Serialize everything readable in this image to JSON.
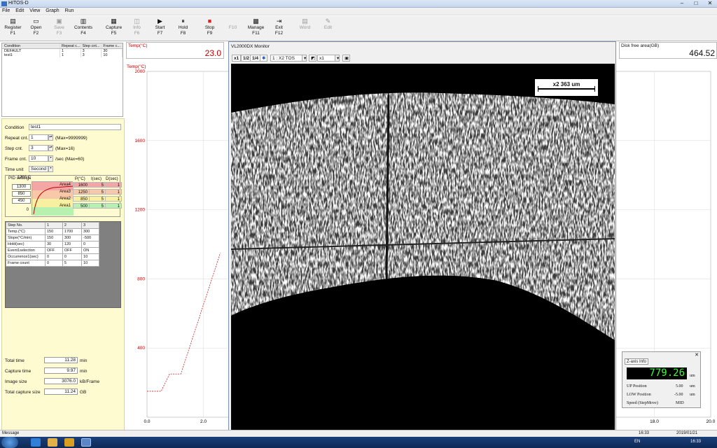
{
  "window": {
    "title": "HITOS-D"
  },
  "menu": [
    "File",
    "Edit",
    "View",
    "Graph",
    "Run"
  ],
  "toolbar": [
    {
      "label": "Register",
      "key": "F1",
      "icon": "register-icon",
      "enabled": true
    },
    {
      "label": "Open",
      "key": "F2",
      "icon": "open-icon",
      "enabled": true
    },
    {
      "label": "Save",
      "key": "F3",
      "icon": "save-icon",
      "enabled": false
    },
    {
      "label": "Contents",
      "key": "F4",
      "icon": "printer-icon",
      "enabled": true
    },
    {
      "label": "Capture",
      "key": "F5",
      "icon": "capture-icon",
      "enabled": true
    },
    {
      "label": "Info",
      "key": "F6",
      "icon": "info-icon",
      "enabled": false
    },
    {
      "label": "Start",
      "key": "F7",
      "icon": "play-icon",
      "enabled": true
    },
    {
      "label": "Hold",
      "key": "F8",
      "icon": "pause-icon",
      "enabled": true
    },
    {
      "label": "Stop",
      "key": "F9",
      "icon": "stop-icon",
      "enabled": true
    },
    {
      "label": "",
      "key": "F10",
      "icon": "",
      "enabled": false
    },
    {
      "label": "Manage",
      "key": "F11",
      "icon": "manage-icon",
      "enabled": true
    },
    {
      "label": "Exit",
      "key": "F12",
      "icon": "exit-icon",
      "enabled": true
    },
    {
      "label": "Word",
      "key": "",
      "icon": "word-icon",
      "enabled": false
    },
    {
      "label": "Edit",
      "key": "",
      "icon": "edit-icon",
      "enabled": false
    }
  ],
  "condition_table": {
    "headers": [
      "Condition",
      "Repeat c...",
      "Step cnt...",
      "Frame c..."
    ],
    "rows": [
      [
        "DEFAULT",
        "1",
        "3",
        "30"
      ],
      [
        "test1",
        "1",
        "3",
        "10"
      ]
    ]
  },
  "settings": {
    "condition_label": "Condition",
    "condition_value": "test1",
    "repeat_label": "Repeat cnt.",
    "repeat_value": "1",
    "repeat_note": "(Max=9999999)",
    "step_label": "Step cnt.",
    "step_value": "3",
    "step_note": "(Max=16)",
    "frame_label": "Frame cnt.",
    "frame_value": "10",
    "frame_note": "/sec (Max=60)",
    "timeunit_label": "Time unit",
    "timeunit_value": "Second"
  },
  "pid": {
    "title": "PID settings",
    "axis_top": "1700",
    "axis_bottom": "0",
    "axis_unit": "C",
    "axis_values": [
      "1300",
      "850",
      "450"
    ],
    "headers": [
      "P(°C)",
      "I(sec)",
      "D(sec)"
    ],
    "rows": [
      {
        "area": "Area4",
        "p": "1600",
        "i": "5",
        "d": "1",
        "color": "#f4a6a6"
      },
      {
        "area": "Area3",
        "p": "1250",
        "i": "5",
        "d": "1",
        "color": "#f8c8a8"
      },
      {
        "area": "Area2",
        "p": "850",
        "i": "5",
        "d": "1",
        "color": "#f7f0a0"
      },
      {
        "area": "Area1",
        "p": "500",
        "i": "5",
        "d": "1",
        "color": "#b8f0b0"
      }
    ]
  },
  "steps": {
    "header": [
      "Step No.",
      "1",
      "2",
      "3"
    ],
    "rows": [
      [
        "Temp.(°C)",
        "150",
        "1700",
        "300"
      ],
      [
        "Slope(°C/min)",
        "150",
        "300",
        "-500"
      ],
      [
        "Hold(sec)",
        "30",
        "120",
        "0"
      ],
      [
        "Event1selection",
        "OFF",
        "OFF",
        "ON"
      ],
      [
        "Occurrence1(sec)",
        "0",
        "0",
        "10"
      ],
      [
        "Frame count",
        "0",
        "5",
        "10"
      ]
    ]
  },
  "totals": [
    {
      "label": "Total time",
      "value": "11.28",
      "unit": "min"
    },
    {
      "label": "Capture time",
      "value": "9.97",
      "unit": "min"
    },
    {
      "label": "Image size",
      "value": "3076.0",
      "unit": "kB/Frame"
    },
    {
      "label": "Total capture size",
      "value": "11.24",
      "unit": "GB"
    }
  ],
  "temp_panel": {
    "label": "Temp(°C)",
    "value": "23.0"
  },
  "disk_panel": {
    "label": "Disk free area(GB)",
    "value": "464.52"
  },
  "chart_data": {
    "type": "line",
    "ylabel": "Temp(°C)",
    "yticks": [
      "2000",
      "1600",
      "1200",
      "800",
      "400"
    ],
    "xticks": [
      "0.0",
      "2.0",
      "18.0",
      "20.0"
    ],
    "ylim": [
      0,
      2000
    ],
    "series": [
      {
        "values": [
          [
            0,
            150
          ],
          [
            0.5,
            150
          ],
          [
            0.8,
            250
          ],
          [
            1.2,
            250
          ],
          [
            2.0,
            650
          ],
          [
            2.6,
            950
          ]
        ]
      }
    ]
  },
  "monitor": {
    "title": "VL2000DX Monitor",
    "zoom_buttons": [
      "x1",
      "1/2",
      "1/4"
    ],
    "lens_select": "1 : X2 TOS",
    "mag_select": "x1",
    "scale_label": "x2  363 um"
  },
  "zaxis": {
    "tab": "Z-axis Info",
    "reading": "779.26",
    "reading_unit": "um",
    "up_label": "UP  Position",
    "up_value": "5.00",
    "up_unit": "um",
    "low_label": "LOW Position",
    "low_value": "-5.00",
    "low_unit": "um",
    "speed_label": "Speed (StepMove)",
    "speed_value": "MID"
  },
  "status": {
    "message": "Message",
    "time_cell": "16:33",
    "date_cell": "2019/01/21"
  },
  "taskbar": {
    "lang": "EN",
    "clock": "16:33"
  }
}
